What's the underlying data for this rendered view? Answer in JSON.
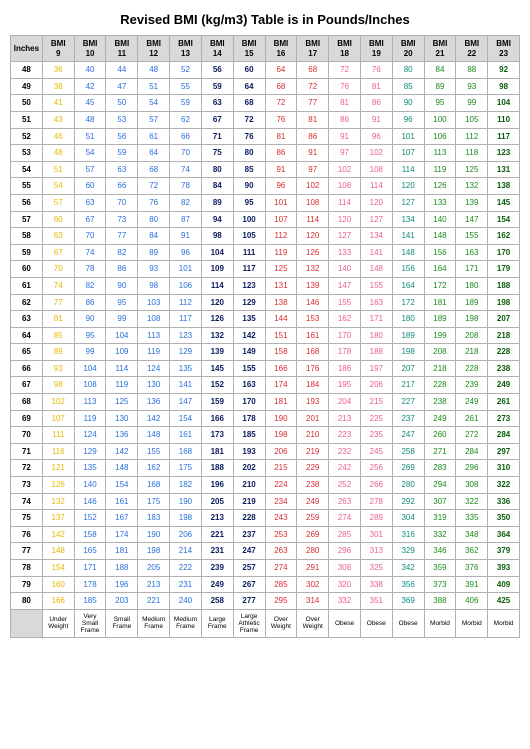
{
  "title": "Revised BMI (kg/m3) Table is in Pounds/Inches",
  "col_prefix": "BMI",
  "row_header": "Inches",
  "bmis": [
    9,
    10,
    11,
    12,
    13,
    14,
    15,
    16,
    17,
    18,
    19,
    20,
    21,
    22,
    23
  ],
  "colors": [
    "gold",
    "blue",
    "blue",
    "blue",
    "blue",
    "navy",
    "navy",
    "red",
    "red",
    "pink",
    "pink",
    "teal",
    "green",
    "green",
    "dgrn"
  ],
  "categories": [
    "Under Weight",
    "Very Small Frame",
    "Small Frame",
    "Medium Frame",
    "Medium Frame",
    "Large Frame",
    "Large Athletic Frame",
    "Over Weight",
    "Over Weight",
    "Obese",
    "Obese",
    "Obese",
    "Morbid",
    "Morbid",
    "Morbid"
  ],
  "rows": [
    {
      "in": 48,
      "v": [
        36,
        40,
        44,
        48,
        52,
        56,
        60,
        64,
        68,
        72,
        76,
        80,
        84,
        88,
        92
      ]
    },
    {
      "in": 49,
      "v": [
        38,
        42,
        47,
        51,
        55,
        59,
        64,
        68,
        72,
        76,
        81,
        85,
        89,
        93,
        98
      ]
    },
    {
      "in": 50,
      "v": [
        41,
        45,
        50,
        54,
        59,
        63,
        68,
        72,
        77,
        81,
        86,
        90,
        95,
        99,
        104
      ]
    },
    {
      "in": 51,
      "v": [
        43,
        48,
        53,
        57,
        62,
        67,
        72,
        76,
        81,
        86,
        91,
        96,
        100,
        105,
        110
      ]
    },
    {
      "in": 52,
      "v": [
        46,
        51,
        56,
        61,
        66,
        71,
        76,
        81,
        86,
        91,
        96,
        101,
        106,
        112,
        117
      ]
    },
    {
      "in": 53,
      "v": [
        48,
        54,
        59,
        64,
        70,
        75,
        80,
        86,
        91,
        97,
        102,
        107,
        113,
        118,
        123
      ]
    },
    {
      "in": 54,
      "v": [
        51,
        57,
        63,
        68,
        74,
        80,
        85,
        91,
        97,
        102,
        108,
        114,
        119,
        125,
        131
      ]
    },
    {
      "in": 55,
      "v": [
        54,
        60,
        66,
        72,
        78,
        84,
        90,
        96,
        102,
        108,
        114,
        120,
        126,
        132,
        138
      ]
    },
    {
      "in": 56,
      "v": [
        57,
        63,
        70,
        76,
        82,
        89,
        95,
        101,
        108,
        114,
        120,
        127,
        133,
        139,
        145
      ]
    },
    {
      "in": 57,
      "v": [
        60,
        67,
        73,
        80,
        87,
        94,
        100,
        107,
        114,
        120,
        127,
        134,
        140,
        147,
        154
      ]
    },
    {
      "in": 58,
      "v": [
        63,
        70,
        77,
        84,
        91,
        98,
        105,
        112,
        120,
        127,
        134,
        141,
        148,
        155,
        162
      ]
    },
    {
      "in": 59,
      "v": [
        67,
        74,
        82,
        89,
        96,
        104,
        111,
        119,
        126,
        133,
        141,
        148,
        156,
        163,
        170
      ]
    },
    {
      "in": 60,
      "v": [
        70,
        78,
        86,
        93,
        101,
        109,
        117,
        125,
        132,
        140,
        148,
        156,
        164,
        171,
        179
      ]
    },
    {
      "in": 61,
      "v": [
        74,
        82,
        90,
        98,
        106,
        114,
        123,
        131,
        139,
        147,
        155,
        164,
        172,
        180,
        188
      ]
    },
    {
      "in": 62,
      "v": [
        77,
        86,
        95,
        103,
        112,
        120,
        129,
        138,
        146,
        155,
        163,
        172,
        181,
        189,
        198
      ]
    },
    {
      "in": 63,
      "v": [
        81,
        90,
        99,
        108,
        117,
        126,
        135,
        144,
        153,
        162,
        171,
        180,
        189,
        198,
        207
      ]
    },
    {
      "in": 64,
      "v": [
        85,
        95,
        104,
        113,
        123,
        132,
        142,
        151,
        161,
        170,
        180,
        189,
        199,
        208,
        218
      ]
    },
    {
      "in": 65,
      "v": [
        89,
        99,
        109,
        119,
        129,
        139,
        149,
        158,
        168,
        178,
        188,
        198,
        208,
        218,
        228
      ]
    },
    {
      "in": 66,
      "v": [
        93,
        104,
        114,
        124,
        135,
        145,
        155,
        166,
        176,
        186,
        197,
        207,
        218,
        228,
        238
      ]
    },
    {
      "in": 67,
      "v": [
        98,
        108,
        119,
        130,
        141,
        152,
        163,
        174,
        184,
        195,
        206,
        217,
        228,
        239,
        249
      ]
    },
    {
      "in": 68,
      "v": [
        102,
        113,
        125,
        136,
        147,
        159,
        170,
        181,
        193,
        204,
        215,
        227,
        238,
        249,
        261
      ]
    },
    {
      "in": 69,
      "v": [
        107,
        119,
        130,
        142,
        154,
        166,
        178,
        190,
        201,
        213,
        225,
        237,
        249,
        261,
        273
      ]
    },
    {
      "in": 70,
      "v": [
        111,
        124,
        136,
        148,
        161,
        173,
        185,
        198,
        210,
        223,
        235,
        247,
        260,
        272,
        284
      ]
    },
    {
      "in": 71,
      "v": [
        116,
        129,
        142,
        155,
        168,
        181,
        193,
        206,
        219,
        232,
        245,
        258,
        271,
        284,
        297
      ]
    },
    {
      "in": 72,
      "v": [
        121,
        135,
        148,
        162,
        175,
        188,
        202,
        215,
        229,
        242,
        256,
        269,
        283,
        296,
        310
      ]
    },
    {
      "in": 73,
      "v": [
        126,
        140,
        154,
        168,
        182,
        196,
        210,
        224,
        238,
        252,
        266,
        280,
        294,
        308,
        322
      ]
    },
    {
      "in": 74,
      "v": [
        132,
        146,
        161,
        175,
        190,
        205,
        219,
        234,
        249,
        263,
        278,
        292,
        307,
        322,
        336
      ]
    },
    {
      "in": 75,
      "v": [
        137,
        152,
        167,
        183,
        198,
        213,
        228,
        243,
        259,
        274,
        289,
        304,
        319,
        335,
        350
      ]
    },
    {
      "in": 76,
      "v": [
        142,
        158,
        174,
        190,
        206,
        221,
        237,
        253,
        269,
        285,
        301,
        316,
        332,
        348,
        364
      ]
    },
    {
      "in": 77,
      "v": [
        148,
        165,
        181,
        198,
        214,
        231,
        247,
        263,
        280,
        296,
        313,
        329,
        346,
        362,
        379
      ]
    },
    {
      "in": 78,
      "v": [
        154,
        171,
        188,
        205,
        222,
        239,
        257,
        274,
        291,
        308,
        325,
        342,
        359,
        376,
        393
      ]
    },
    {
      "in": 79,
      "v": [
        160,
        178,
        196,
        213,
        231,
        249,
        267,
        285,
        302,
        320,
        338,
        356,
        373,
        391,
        409
      ]
    },
    {
      "in": 80,
      "v": [
        166,
        185,
        203,
        221,
        240,
        258,
        277,
        295,
        314,
        332,
        351,
        369,
        388,
        406,
        425
      ]
    }
  ]
}
